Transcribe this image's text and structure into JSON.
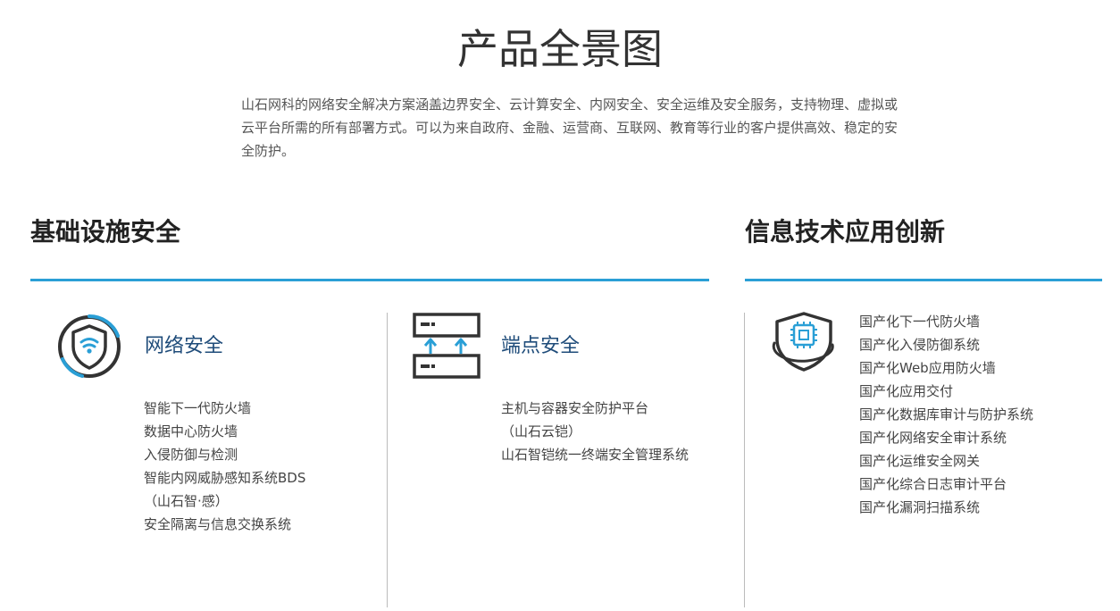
{
  "header": {
    "title": "产品全景图",
    "intro": "山石网科的网络安全解决方案涵盖边界安全、云计算安全、内网安全、安全运维及安全服务，支持物理、虚拟或云平台所需的所有部署方式。可以为来自政府、金融、运营商、互联网、教育等行业的客户提供高效、稳定的安全防护。"
  },
  "sections": {
    "infrastructure": {
      "title": "基础设施安全",
      "rule_color": "#2a9fd6",
      "cards": [
        {
          "title": "网络安全",
          "icon": "network-security-shield-icon",
          "items": [
            "智能下一代防火墙",
            "数据中心防火墙",
            "入侵防御与检测",
            "智能内网威胁感知系统BDS",
            "（山石智·感）",
            "安全隔离与信息交换系统"
          ]
        },
        {
          "title": "端点安全",
          "icon": "endpoint-servers-icon",
          "items": [
            "主机与容器安全防护平台",
            "（山石云铠）",
            "山石智铠统一终端安全管理系统"
          ]
        }
      ]
    },
    "xinchuang": {
      "title": "信息技术应用创新",
      "icon": "chip-shield-icon",
      "items": [
        "国产化下一代防火墙",
        "国产化入侵防御系统",
        "国产化Web应用防火墙",
        "国产化应用交付",
        "国产化数据库审计与防护系统",
        "国产化网络安全审计系统",
        "国产化运维安全网关",
        "国产化综合日志审计平台",
        "国产化漏洞扫描系统"
      ]
    }
  },
  "colors": {
    "accent": "#2a9fd6",
    "card_title": "#1f4c7a",
    "icon_dark": "#333333"
  }
}
